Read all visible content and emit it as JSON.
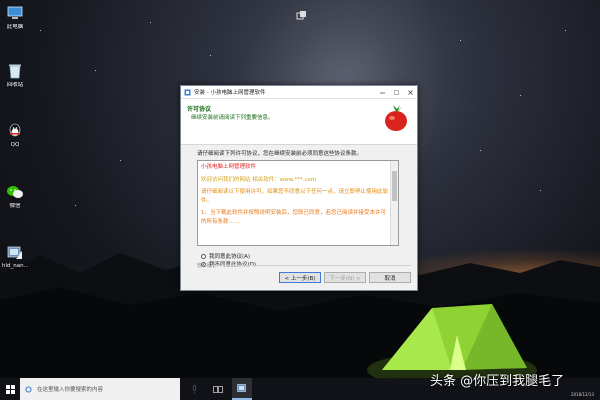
{
  "desktop": {
    "icons": [
      {
        "label": "此电脑",
        "icon": "computer-icon"
      },
      {
        "label": "回收站",
        "icon": "recycle-bin-icon"
      },
      {
        "label": "QQ",
        "icon": "qq-icon"
      },
      {
        "label": "微信",
        "icon": "wechat-icon"
      },
      {
        "label": "hld_nan...",
        "icon": "installer-icon"
      }
    ]
  },
  "installer": {
    "title": "安装 - 小孩电脑上网管理软件",
    "header_title": "许可协议",
    "header_subtitle": "继续安装前请阅读下列重要信息。",
    "intro": "请仔细阅读下列许可协议，您在继续安装前必须同意这些协议条款。",
    "license": {
      "title": "小孩电脑上网管理软件",
      "p1": "欢迎访问我们的网站 相关软件：www.***.com",
      "p2": "请仔细阅读以下使用许可，如果您不同意以下任何一点，请立即停止使用此软件。",
      "p3": "1、当下载此软件并按照说明安装后，您即已同意，若您已阅读并接受本许可的所有条款……"
    },
    "radio_accept": "我同意此协议(A)",
    "radio_decline": "我不同意此协议(D)",
    "footer_label": "软件助手",
    "buttons": {
      "back": "< 上一步(B)",
      "next": "下一步(N) >",
      "cancel": "取消"
    }
  },
  "taskbar": {
    "search_placeholder": "在这里输入你要搜索的内容",
    "clock": "2018/12/13"
  },
  "watermark": "头条 @你压到我腿毛了",
  "colors": {
    "license_title": "#e02424",
    "header_green": "#1a6d1a",
    "tent_green": "#9fe03a"
  }
}
